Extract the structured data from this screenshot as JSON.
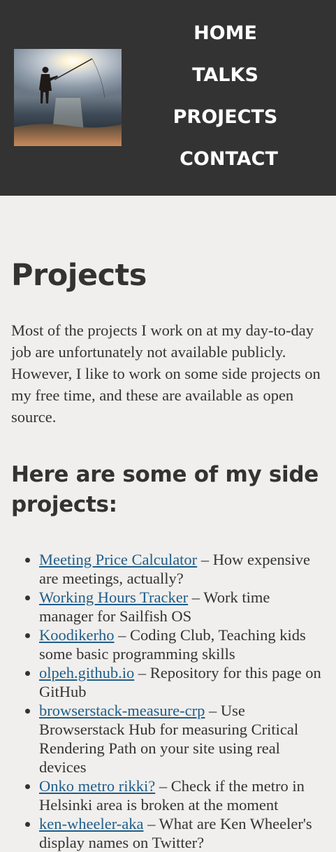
{
  "header": {
    "background": "#333333",
    "photo": "fisherman-silhouette-at-sunset",
    "nav": {
      "home": "HOME",
      "talks": "TALKS",
      "projects": "PROJECTS",
      "contact": "CONTACT"
    }
  },
  "main": {
    "title": "Projects",
    "intro": "Most of the projects I work on at my day-to-day job are unfortunately not available publicly. However, I like to work on some side projects on my free time, and these are available as open source.",
    "subtitle": "Here are some of my side projects:",
    "projects": [
      {
        "name": "Meeting Price Calculator",
        "desc": " – How expensive are meetings, actually?"
      },
      {
        "name": "Working Hours Tracker",
        "desc": " – Work time manager for Sailfish OS"
      },
      {
        "name": "Koodikerho",
        "desc": " – Coding Club, Teaching kids some basic programming skills"
      },
      {
        "name": "olpeh.github.io",
        "desc": " – Repository for this page on GitHub"
      },
      {
        "name": "browserstack-measure-crp",
        "desc": " – Use Browserstack Hub for measuring Critical Rendering Path on your site using real devices"
      },
      {
        "name": "Onko metro rikki?",
        "desc": " – Check if the metro in Helsinki area is broken at the moment"
      },
      {
        "name": "ken-wheeler-aka",
        "desc": " – What are Ken Wheeler's display names on Twitter?"
      }
    ]
  },
  "colors": {
    "header_bg": "#333333",
    "page_bg": "#f0efed",
    "text": "#333333",
    "link": "#1f5d8a"
  }
}
